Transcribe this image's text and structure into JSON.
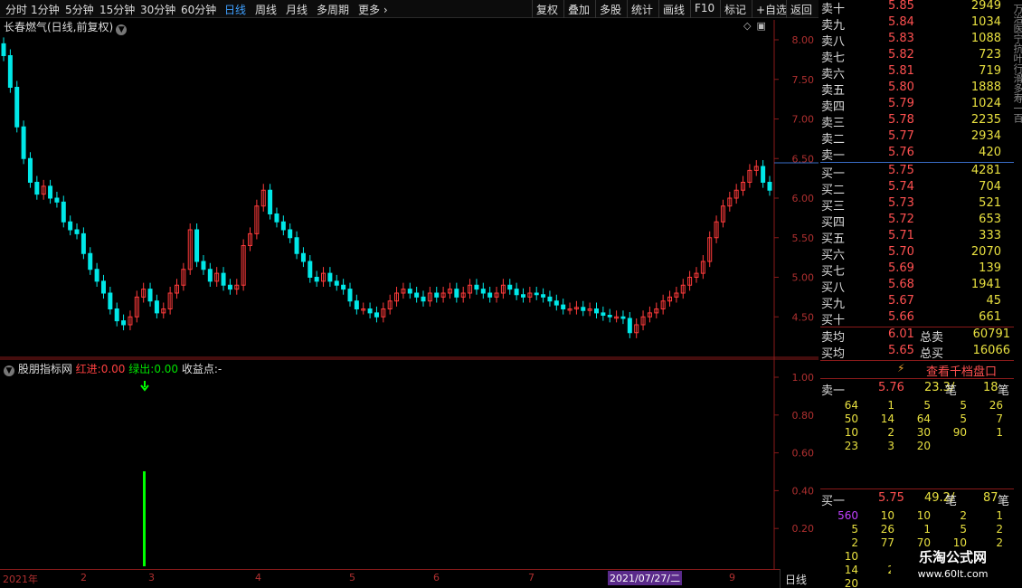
{
  "toolbar": {
    "periods": [
      "分时",
      "1分钟",
      "5分钟",
      "15分钟",
      "30分钟",
      "60分钟",
      "日线",
      "周线",
      "月线",
      "多周期",
      "更多"
    ],
    "selected_period": "日线",
    "right_buttons": [
      "复权",
      "叠加",
      "多股",
      "统计",
      "画线",
      "F10",
      "标记",
      "+自选",
      "返回"
    ]
  },
  "chart_title": "长春燃气(日线,前复权)",
  "main_yticks": [
    "8.00",
    "7.50",
    "7.00",
    "6.50",
    "6.00",
    "5.50",
    "5.00",
    "4.50"
  ],
  "indicator": {
    "name": "股朋指标网",
    "red_label": "红进:",
    "red_value": "0.00",
    "green_label": "绿出:",
    "green_value": "0.00",
    "profit_label": "收益点:",
    "profit_value": "-"
  },
  "ind_yticks": [
    "1.00",
    "0.80",
    "0.60",
    "0.40",
    "0.20"
  ],
  "date_axis": [
    "2021年",
    "2",
    "3",
    "4",
    "5",
    "6",
    "7",
    "8",
    "9"
  ],
  "date_highlight": "2021/07/27/二",
  "period_label": "日线",
  "order_book": {
    "asks": [
      {
        "label": "卖十",
        "price": "5.85",
        "vol": "2949"
      },
      {
        "label": "卖九",
        "price": "5.84",
        "vol": "1034"
      },
      {
        "label": "卖八",
        "price": "5.83",
        "vol": "1088"
      },
      {
        "label": "卖七",
        "price": "5.82",
        "vol": "723"
      },
      {
        "label": "卖六",
        "price": "5.81",
        "vol": "719"
      },
      {
        "label": "卖五",
        "price": "5.80",
        "vol": "1888"
      },
      {
        "label": "卖四",
        "price": "5.79",
        "vol": "1024"
      },
      {
        "label": "卖三",
        "price": "5.78",
        "vol": "2235"
      },
      {
        "label": "卖二",
        "price": "5.77",
        "vol": "2934"
      },
      {
        "label": "卖一",
        "price": "5.76",
        "vol": "420"
      }
    ],
    "bids": [
      {
        "label": "买一",
        "price": "5.75",
        "vol": "4281"
      },
      {
        "label": "买二",
        "price": "5.74",
        "vol": "704"
      },
      {
        "label": "买三",
        "price": "5.73",
        "vol": "521"
      },
      {
        "label": "买四",
        "price": "5.72",
        "vol": "653"
      },
      {
        "label": "买五",
        "price": "5.71",
        "vol": "333"
      },
      {
        "label": "买六",
        "price": "5.70",
        "vol": "2070"
      },
      {
        "label": "买七",
        "price": "5.69",
        "vol": "139"
      },
      {
        "label": "买八",
        "price": "5.68",
        "vol": "1941"
      },
      {
        "label": "买九",
        "price": "5.67",
        "vol": "45"
      },
      {
        "label": "买十",
        "price": "5.66",
        "vol": "661"
      }
    ],
    "ask_avg_label": "卖均",
    "ask_avg": "6.01",
    "total_sell_label": "总卖",
    "total_sell": "60791",
    "bid_avg_label": "买均",
    "bid_avg": "5.65",
    "total_buy_label": "总买",
    "total_buy": "16066",
    "view_depth_label": "查看千档盘口"
  },
  "queue_sell": {
    "label": "卖一",
    "price": "5.76",
    "avg": "23.3/",
    "unit": "笔",
    "count": "18",
    "count_unit": "笔",
    "rows": [
      [
        "64",
        "1",
        "5",
        "5",
        "26"
      ],
      [
        "50",
        "14",
        "64",
        "5",
        "7"
      ],
      [
        "10",
        "2",
        "30",
        "90",
        "1"
      ],
      [
        "23",
        "3",
        "20",
        "",
        ""
      ]
    ]
  },
  "queue_buy": {
    "label": "买一",
    "price": "5.75",
    "avg": "49.2/",
    "unit": "笔",
    "count": "87",
    "count_unit": "笔",
    "rows": [
      [
        "560",
        "10",
        "10",
        "2",
        "1"
      ],
      [
        "5",
        "26",
        "1",
        "5",
        "2"
      ],
      [
        "2",
        "77",
        "70",
        "10",
        "2"
      ],
      [
        "10",
        "",
        "",
        "",
        ""
      ],
      [
        "14",
        "2",
        "",
        "",
        ""
      ],
      [
        "20",
        "",
        "",
        "",
        ""
      ]
    ]
  },
  "edge_text": "万治医宁抗叶行滑多寿一百",
  "watermark": {
    "line1": "乐淘公式网",
    "line2": "www.60lt.com"
  },
  "colors": {
    "up": "#ff3b3b",
    "down": "#00e8e8",
    "signal": "#00ff00",
    "axis": "#8a1a1a"
  }
}
